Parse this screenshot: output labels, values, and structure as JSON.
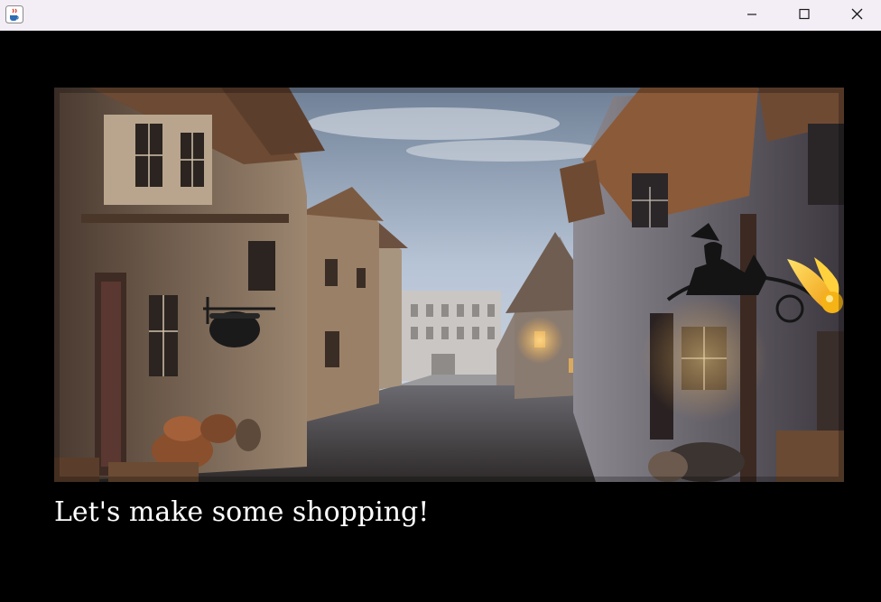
{
  "window": {
    "title": "",
    "app_icon": "java-cup-icon",
    "controls": {
      "minimize": "minimize-icon",
      "maximize": "maximize-icon",
      "close": "close-icon"
    }
  },
  "scene": {
    "name": "diagon-alley-street",
    "icons": [
      "golden-snitch-icon",
      "witch-sign-icon",
      "cauldron-sign-icon"
    ]
  },
  "dialog": {
    "text": "Let's make some shopping!"
  },
  "colors": {
    "titlebar": "#f3eef5",
    "background": "#000000",
    "text": "#ffffff",
    "snitch": "#f5b316"
  }
}
